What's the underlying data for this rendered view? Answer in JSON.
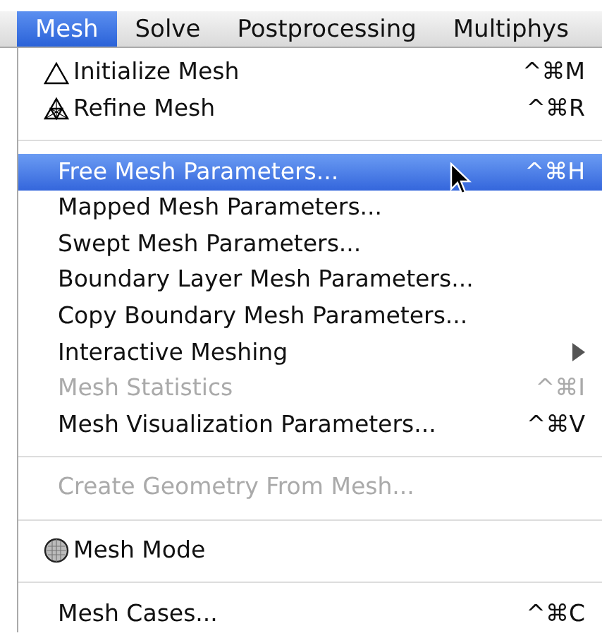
{
  "menubar": [
    {
      "label": "Mesh",
      "selected": true
    },
    {
      "label": "Solve",
      "selected": false
    },
    {
      "label": "Postprocessing",
      "selected": false
    },
    {
      "label": "Multiphys",
      "selected": false
    }
  ],
  "menu": [
    {
      "kind": "iconitem",
      "label": "Initialize Mesh",
      "shortcut": "^⌘M",
      "selected": false,
      "disabled": false
    },
    {
      "kind": "iconitem",
      "label": "Refine Mesh",
      "shortcut": "^⌘R",
      "selected": false,
      "disabled": false
    },
    {
      "kind": "separator"
    },
    {
      "kind": "item",
      "label": "Free Mesh Parameters...",
      "shortcut": "^⌘H",
      "selected": true,
      "disabled": false
    },
    {
      "kind": "item",
      "label": "Mapped Mesh Parameters...",
      "selected": false,
      "disabled": false
    },
    {
      "kind": "item",
      "label": "Swept Mesh Parameters...",
      "selected": false,
      "disabled": false
    },
    {
      "kind": "item",
      "label": "Boundary Layer Mesh Parameters...",
      "selected": false,
      "disabled": false
    },
    {
      "kind": "item",
      "label": "Copy Boundary Mesh Parameters...",
      "selected": false,
      "disabled": false
    },
    {
      "kind": "submenu",
      "label": "Interactive Meshing",
      "selected": false,
      "disabled": false
    },
    {
      "kind": "item",
      "label": "Mesh Statistics",
      "shortcut": "^⌘I",
      "selected": false,
      "disabled": true
    },
    {
      "kind": "item",
      "label": "Mesh Visualization Parameters...",
      "shortcut": "^⌘V",
      "selected": false,
      "disabled": false
    },
    {
      "kind": "separator"
    },
    {
      "kind": "item",
      "label": "Create Geometry From Mesh...",
      "selected": false,
      "disabled": true
    },
    {
      "kind": "separator"
    },
    {
      "kind": "iconitem",
      "label": "Mesh Mode",
      "selected": false,
      "disabled": false
    },
    {
      "kind": "separator"
    },
    {
      "kind": "item",
      "label": "Mesh Cases...",
      "shortcut": "^⌘C",
      "selected": false,
      "disabled": false
    }
  ]
}
